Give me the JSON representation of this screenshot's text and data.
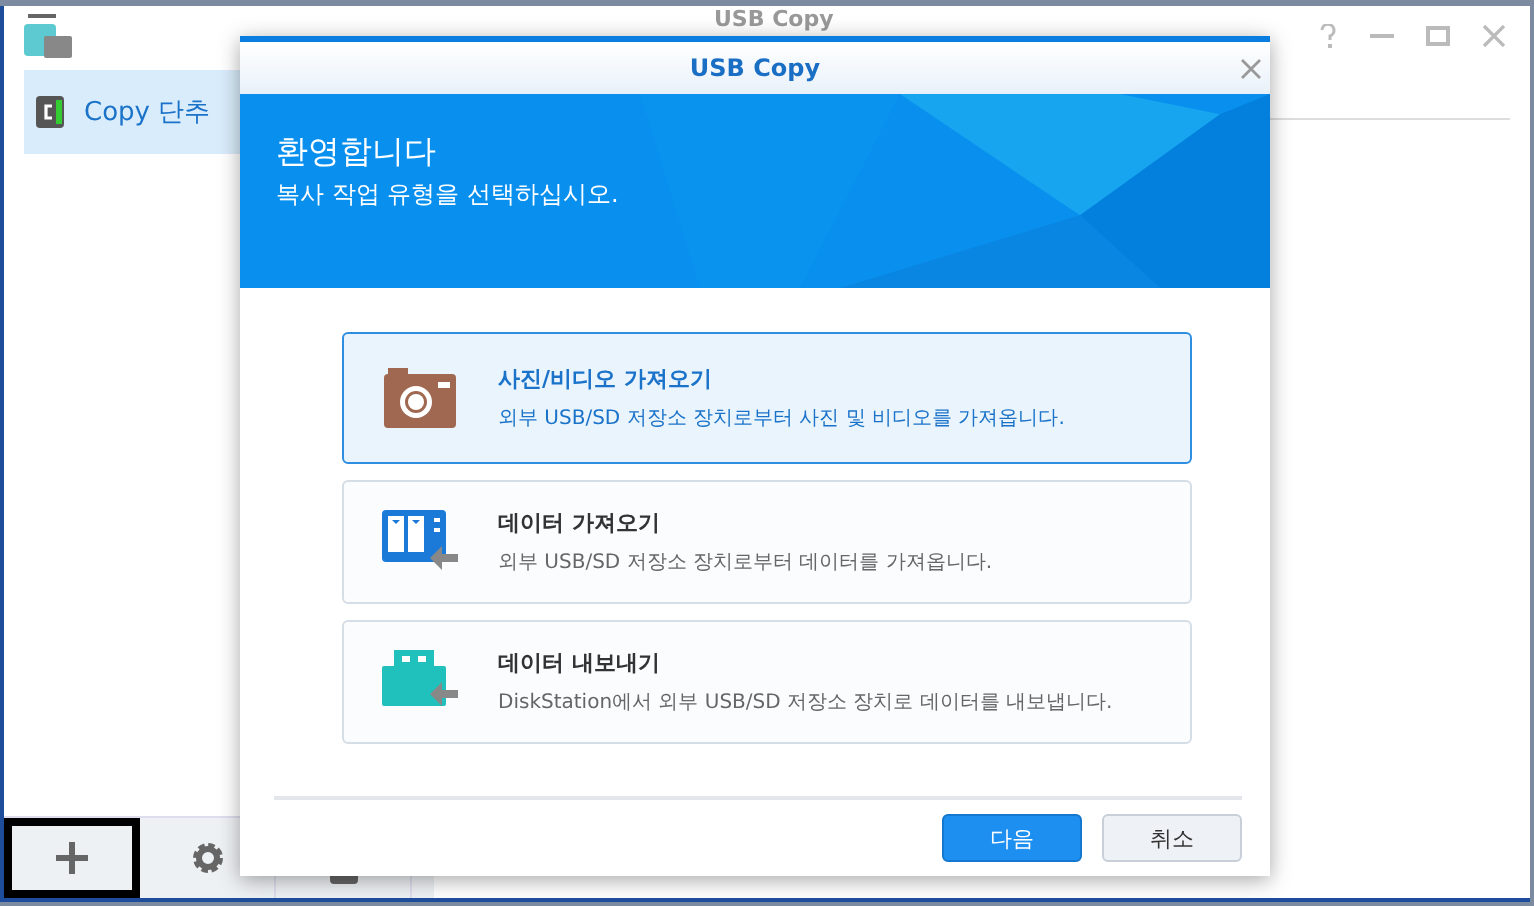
{
  "window": {
    "title": "USB Copy"
  },
  "sidebar": {
    "items": [
      {
        "label": "Copy 단추",
        "selected": true
      }
    ]
  },
  "toolbar": {
    "buttons": [
      {
        "kind": "add",
        "highlighted": true
      },
      {
        "kind": "settings",
        "highlighted": false
      },
      {
        "kind": "log",
        "highlighted": false
      }
    ]
  },
  "dialog": {
    "title": "USB Copy",
    "banner": {
      "heading": "환영합니다",
      "subtitle": "복사 작업 유형을 선택하십시오."
    },
    "options": [
      {
        "kind": "camera",
        "title": "사진/비디오 가져오기",
        "description": "외부 USB/SD 저장소 장치로부터 사진 및 비디오를 가져옵니다.",
        "selected": true
      },
      {
        "kind": "nas",
        "title": "데이터 가져오기",
        "description": "외부 USB/SD 저장소 장치로부터 데이터를 가져옵니다.",
        "selected": false
      },
      {
        "kind": "usb",
        "title": "데이터 내보내기",
        "description": "DiskStation에서 외부 USB/SD 저장소 장치로 데이터를 내보냅니다.",
        "selected": false
      }
    ],
    "buttons": [
      {
        "label": "다음",
        "kind": "primary"
      },
      {
        "label": "취소",
        "kind": "secondary"
      }
    ]
  }
}
